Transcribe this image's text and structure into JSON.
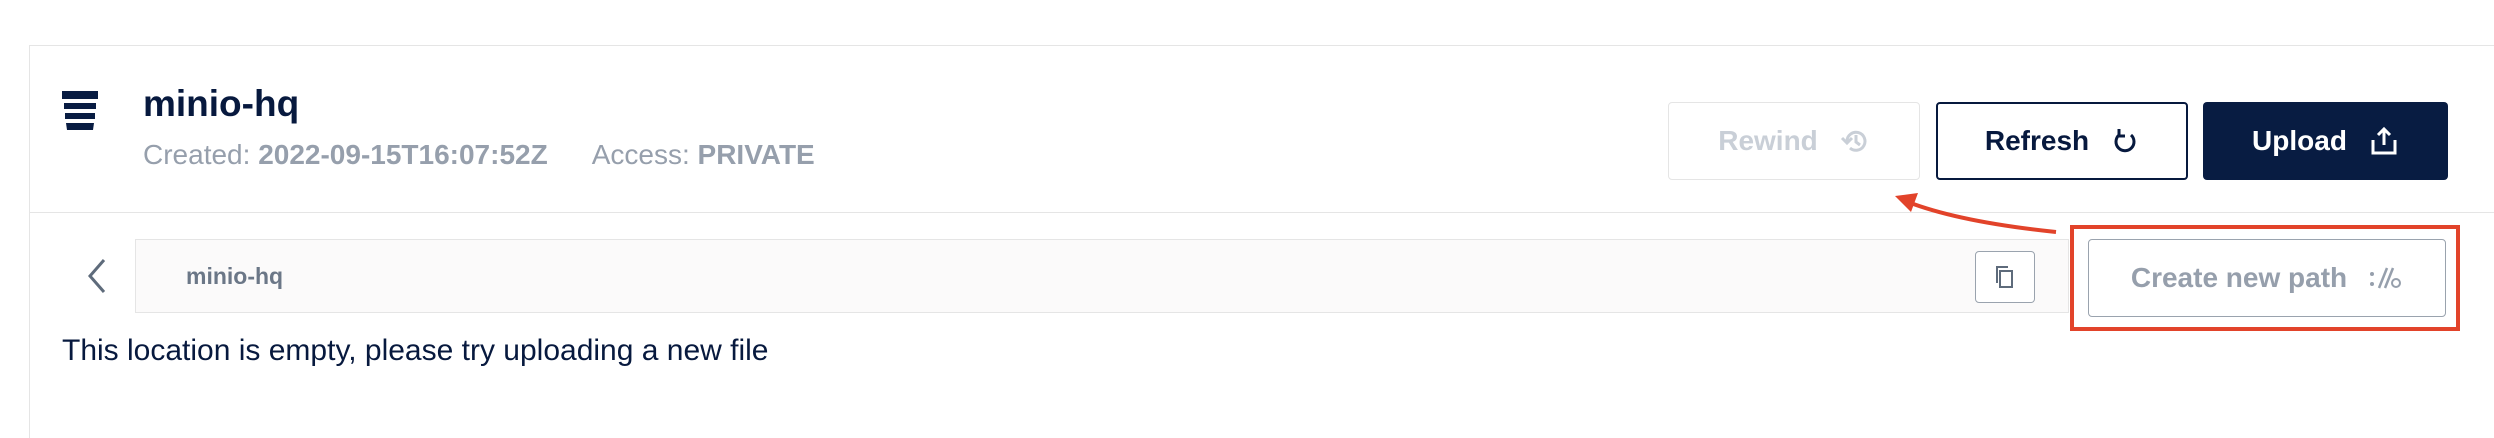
{
  "bucket": {
    "name": "minio-hq",
    "created_label": "Created:",
    "created_value": "2022-09-15T16:07:52Z",
    "access_label": "Access:",
    "access_value": "PRIVATE"
  },
  "toolbar": {
    "rewind_label": "Rewind",
    "refresh_label": "Refresh",
    "upload_label": "Upload"
  },
  "breadcrumb": {
    "path": "minio-hq"
  },
  "actions": {
    "create_path_label": "Create new path"
  },
  "content": {
    "empty_message": "This location is empty, please try uploading a new file"
  },
  "colors": {
    "primary": "#081C42",
    "annotation": "#E2432A",
    "muted_text": "#969FAC"
  }
}
